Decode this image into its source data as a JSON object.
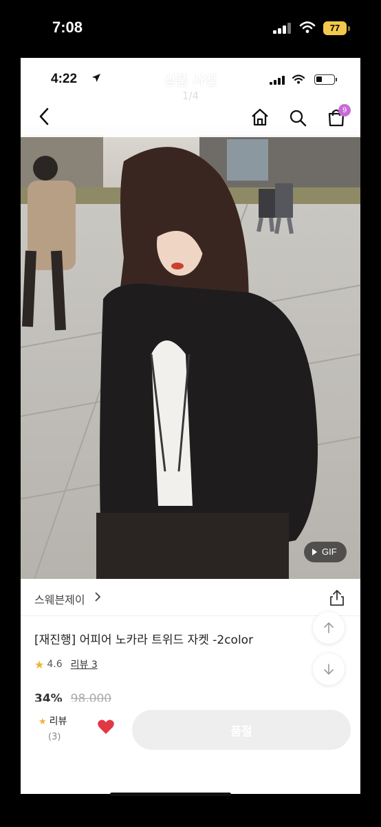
{
  "outer_status": {
    "time": "7:08",
    "battery": "77"
  },
  "inner_status": {
    "time": "4:22"
  },
  "viewer": {
    "title": "상품 사진",
    "counter": "1/4"
  },
  "nav": {
    "cart_count": "9"
  },
  "photo": {
    "gif_label": "GIF"
  },
  "product": {
    "brand": "스웨븐제이",
    "title": "[재진행] 어피어 노카라 트위드 자켓 -2color",
    "rating": "4.6",
    "review_link": "리뷰 3",
    "discount": "34%",
    "original_price": "98,000"
  },
  "bottom_bar": {
    "review_label": "리뷰",
    "review_count": "(3)",
    "soldout_label": "품절"
  },
  "colors": {
    "accent_star": "#f2b134",
    "heart": "#e23744",
    "badge": "#c86ad6",
    "battery": "#f2c94c"
  }
}
